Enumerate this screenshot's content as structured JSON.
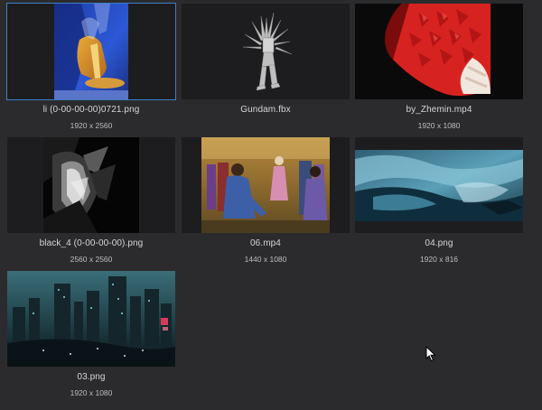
{
  "assets": [
    {
      "name": "li (0-00-00-00)0721.png",
      "dims": "1920 x 2560",
      "selected": true
    },
    {
      "name": "Gundam.fbx",
      "dims": ""
    },
    {
      "name": "by_Zhemin.mp4",
      "dims": "1920 x 1080"
    },
    {
      "name": "black_4 (0-00-00-00).png",
      "dims": "2560 x 2560"
    },
    {
      "name": "06.mp4",
      "dims": "1440 x 1080"
    },
    {
      "name": "04.png",
      "dims": "1920 x 816"
    },
    {
      "name": "03.png",
      "dims": "1920 x 1080"
    }
  ],
  "colors": {
    "background": "#2b2b2d",
    "tile": "#1d1d1f",
    "selection": "#3d7fc4"
  }
}
